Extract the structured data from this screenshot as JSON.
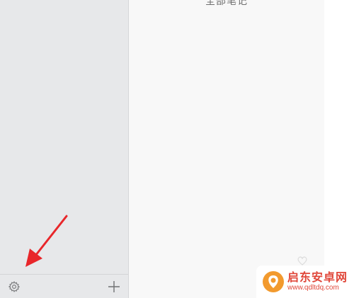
{
  "main": {
    "title": "全部笔记"
  },
  "sidebar": {
    "footer": {
      "settings_icon": "gear-icon",
      "add_icon": "plus-icon"
    }
  },
  "annotation": {
    "arrow_color": "#e8262a"
  },
  "watermark": {
    "brand": "启东安卓网",
    "url": "www.qdltdq.com"
  }
}
